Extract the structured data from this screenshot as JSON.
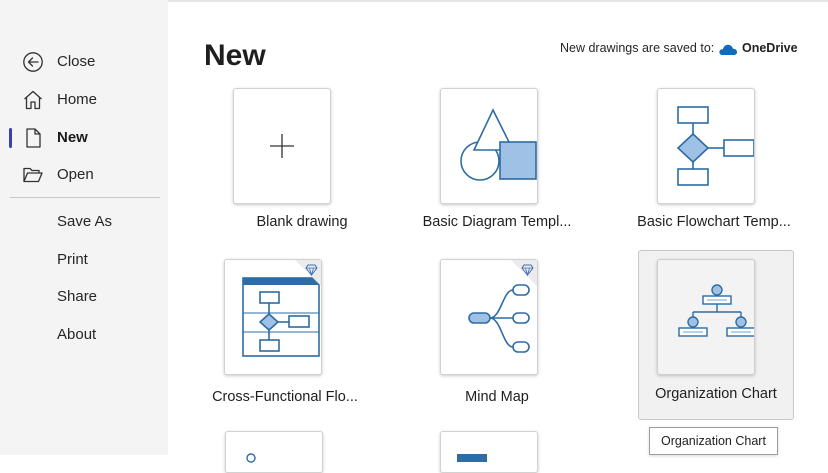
{
  "sidebar": {
    "items": [
      {
        "label": "Close",
        "icon": "back-arrow-icon"
      },
      {
        "label": "Home",
        "icon": "home-icon"
      },
      {
        "label": "New",
        "icon": "new-document-icon",
        "active": true
      },
      {
        "label": "Open",
        "icon": "open-folder-icon"
      },
      {
        "label": "Save As"
      },
      {
        "label": "Print"
      },
      {
        "label": "Share"
      },
      {
        "label": "About"
      }
    ]
  },
  "main": {
    "title": "New",
    "save_note": "New drawings are saved to:",
    "save_location": "OneDrive",
    "save_location_icon": "onedrive-cloud-icon",
    "templates": [
      {
        "label": "Blank drawing",
        "icon": "plus-icon"
      },
      {
        "label": "Basic Diagram Templ...",
        "icon": "basic-shapes-icon"
      },
      {
        "label": "Basic Flowchart Temp...",
        "icon": "flowchart-icon"
      },
      {
        "label": "Cross-Functional Flo...",
        "icon": "swimlane-flowchart-icon",
        "premium": true
      },
      {
        "label": "Mind Map",
        "icon": "mind-map-icon",
        "premium": true
      },
      {
        "label": "Organization Chart",
        "icon": "org-chart-icon",
        "selected": true
      }
    ],
    "tooltip": "Organization Chart"
  },
  "colors": {
    "accent": "#2e6ca4",
    "fill": "#9fc1e6",
    "active_indicator": "#3b3fb5",
    "sidebar_bg": "#f4f4f4"
  }
}
